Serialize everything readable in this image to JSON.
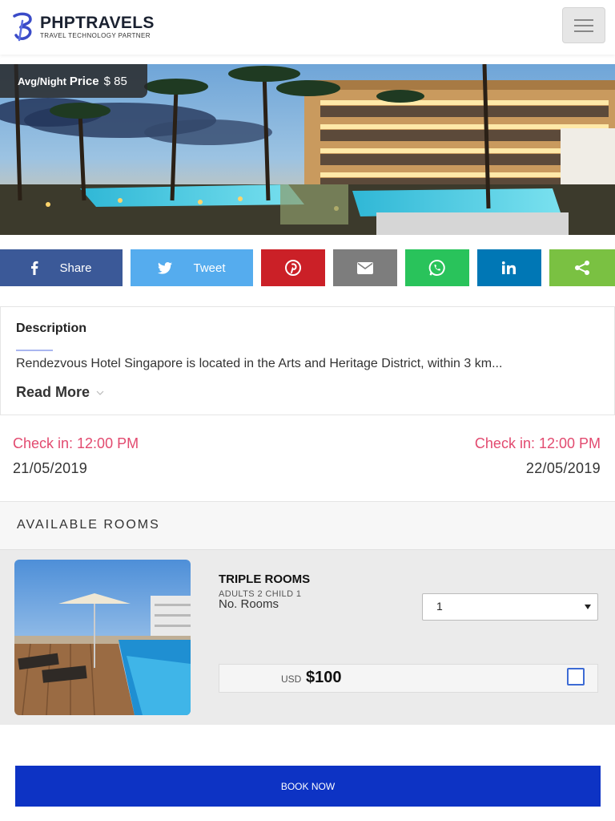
{
  "header": {
    "logo_title": "PHPTRAVELS",
    "logo_tagline": "TRAVEL TECHNOLOGY PARTNER",
    "brand_color": "#3a4bc8"
  },
  "hero": {
    "avg_night_label": "Avg/Night",
    "price_label": "Price",
    "price_value": "$ 85"
  },
  "share": {
    "facebook_label": "Share",
    "twitter_label": "Tweet",
    "colors": {
      "facebook": "#3b5998",
      "twitter": "#55acee",
      "pinterest": "#cb2027",
      "email": "#7d7d7d",
      "whatsapp": "#29c35b",
      "linkedin": "#0077b5",
      "share": "#7ac142"
    }
  },
  "description": {
    "title": "Description",
    "text": "Rendezvous Hotel Singapore is located in the Arts and Heritage District, within 3 km...",
    "read_more": "Read More"
  },
  "checkin": {
    "left_label": "Check in: 12:00 PM",
    "left_date": "21/05/2019",
    "right_label": "Check in: 12:00 PM",
    "right_date": "22/05/2019"
  },
  "rooms": {
    "heading": "AVAILABLE ROOMS",
    "items": [
      {
        "name": "TRIPLE ROOMS",
        "occupancy": "ADULTS 2 CHILD 1",
        "no_rooms_label": "No. Rooms",
        "selected_rooms": "1",
        "currency": "USD",
        "price": "$100"
      }
    ]
  },
  "book_now": "BOOK NOW"
}
